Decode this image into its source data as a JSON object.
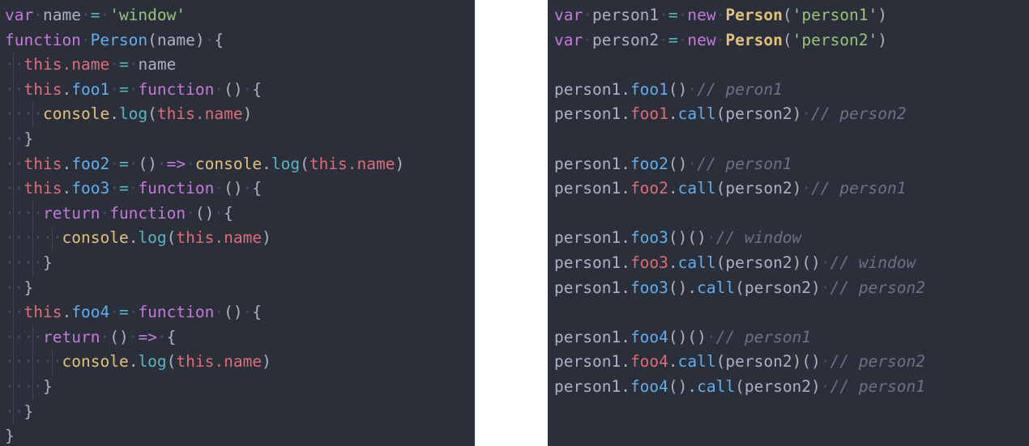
{
  "theme": {
    "background": "#2b2f3a",
    "gap_background": "#ffffff",
    "keyword": "#c678dd",
    "function": "#61afef",
    "class": "#e5c07b",
    "string": "#98c379",
    "operator": "#56b6c2",
    "property": "#e06c75",
    "console": "#e5c07b",
    "method_log": "#56b6c2",
    "punctuation": "#abb2bf",
    "comment": "#6b7280",
    "whitespace_dot": "#4a505e",
    "indent_guide": "#3f4552"
  },
  "left_pane": {
    "name": "constructor-definition-code",
    "lines": [
      "var name = 'window'",
      "function Person(name) {",
      "  this.name = name",
      "  this.foo1 = function () {",
      "    console.log(this.name)",
      "  }",
      "  this.foo2 = () => console.log(this.name)",
      "  this.foo3 = function () {",
      "    return function () {",
      "      console.log(this.name)",
      "    }",
      "  }",
      "  this.foo4 = function () {",
      "    return () => {",
      "      console.log(this.name)",
      "    }",
      "  }",
      "}"
    ]
  },
  "right_pane": {
    "name": "invocation-results-code",
    "lines": [
      "var person1 = new Person('person1')",
      "var person2 = new Person('person2')",
      "",
      "person1.foo1() // peron1",
      "person1.foo1.call(person2) // person2",
      "",
      "person1.foo2() // person1",
      "person1.foo2.call(person2) // person1",
      "",
      "person1.foo3()() // window",
      "person1.foo3.call(person2)() // window",
      "person1.foo3().call(person2) // person2",
      "",
      "person1.foo4()() // person1",
      "person1.foo4.call(person2)() // person2",
      "person1.foo4().call(person2) // person1"
    ]
  },
  "tokens": {
    "kw_var": "var",
    "kw_function": "function",
    "kw_new": "new",
    "kw_return": "return",
    "arrow": "=>",
    "eq": "=",
    "name_ident": "name",
    "this_ident": "this",
    "console_ident": "console",
    "log_ident": "log",
    "person_cls": "Person",
    "str_window": "'window'",
    "str_person1": "'person1'",
    "str_person2": "'person2'",
    "person1_ident": "person1",
    "person2_ident": "person2",
    "call_ident": "call",
    "foo1": "foo1",
    "foo2": "foo2",
    "foo3": "foo3",
    "foo4": "foo4",
    "cmt_peron1": "// peron1",
    "cmt_person1": "// person1",
    "cmt_person2": "// person2",
    "cmt_window": "// window",
    "dot": ".",
    "lparen": "(",
    "rparen": ")",
    "parens": "()",
    "lbrace": "{",
    "rbrace": "}",
    "ws_dot": "·"
  }
}
